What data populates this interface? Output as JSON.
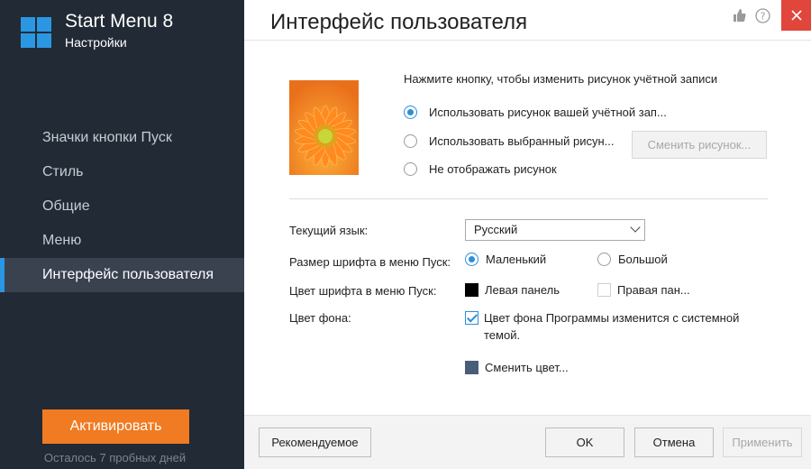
{
  "sidebar": {
    "app_title": "Start Menu 8",
    "app_subtitle": "Настройки",
    "items": [
      {
        "label": "Значки кнопки Пуск"
      },
      {
        "label": "Стиль"
      },
      {
        "label": "Общие"
      },
      {
        "label": "Меню"
      },
      {
        "label": "Интерфейс пользователя",
        "active": true
      }
    ],
    "activate_label": "Активировать",
    "trial_text": "Осталось 7 пробных дней",
    "accent_color": "#2b97e3",
    "activate_color": "#f07b22"
  },
  "header": {
    "title": "Интерфейс пользователя",
    "icons": [
      "thumbs-up-icon",
      "help-icon",
      "close-icon"
    ]
  },
  "account_picture": {
    "hint": "Нажмите кнопку, чтобы изменить рисунок учётной записи",
    "options": [
      {
        "label": "Использовать рисунок вашей учётной зап...",
        "checked": true
      },
      {
        "label": "Использовать выбранный рисун...",
        "checked": false
      },
      {
        "label": "Не отображать рисунок",
        "checked": false
      }
    ],
    "change_button": "Сменить рисунок..."
  },
  "settings": {
    "language_label": "Текущий язык:",
    "language_value": "Русский",
    "font_size_label": "Размер шрифта в меню Пуск:",
    "font_size_options": [
      {
        "label": "Маленький",
        "checked": true
      },
      {
        "label": "Большой",
        "checked": false
      }
    ],
    "font_color_label": "Цвет шрифта в меню Пуск:",
    "font_color_options": [
      {
        "label": "Левая панель",
        "color": "#000000"
      },
      {
        "label": "Правая пан...",
        "color": "#ffffff"
      }
    ],
    "background_label": "Цвет фона:",
    "background_checkbox": "Цвет фона Программы изменится с системной темой.",
    "background_checked": true,
    "change_color_label": "Сменить цвет...",
    "change_color_swatch": "#4a5d78"
  },
  "footer": {
    "recommended": "Рекомендуемое",
    "ok": "OK",
    "cancel": "Отмена",
    "apply": "Применить"
  }
}
